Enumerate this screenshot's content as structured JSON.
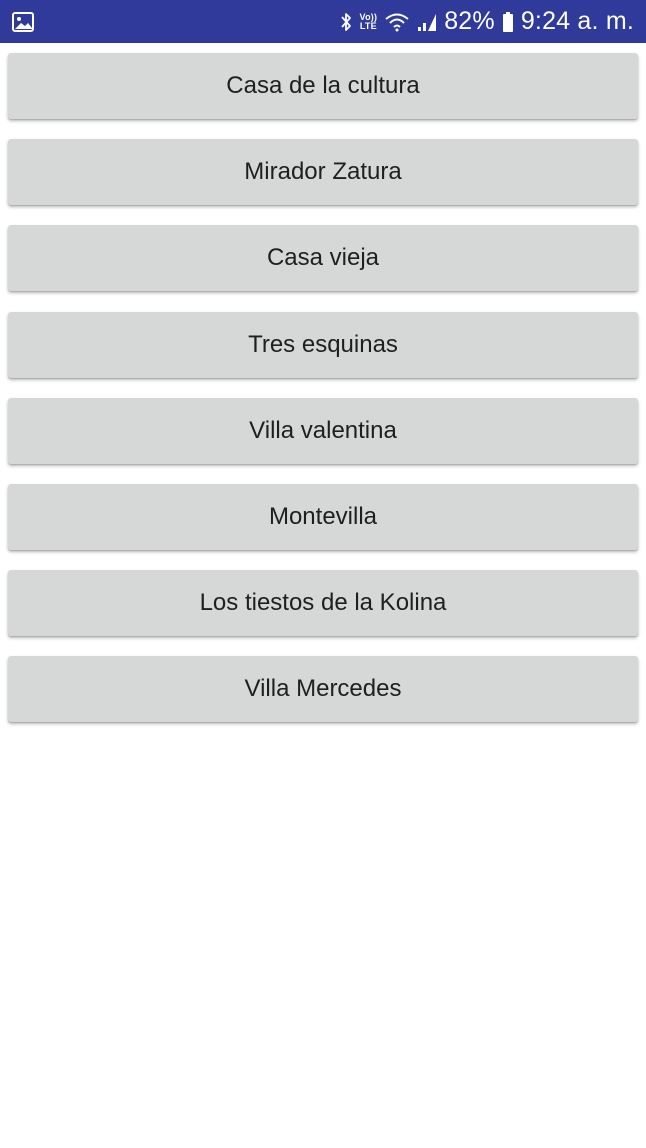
{
  "status_bar": {
    "battery": "82%",
    "time": "9:24 a. m.",
    "volte_top": "Vo))",
    "volte_bottom": "LTE",
    "icons": [
      "image-icon",
      "bluetooth-icon",
      "volte-icon",
      "wifi-icon",
      "signal-icon",
      "battery-icon"
    ],
    "background_color": "#2f3a9b"
  },
  "places": [
    {
      "label": "Casa de la cultura"
    },
    {
      "label": "Mirador Zatura"
    },
    {
      "label": "Casa vieja"
    },
    {
      "label": "Tres esquinas"
    },
    {
      "label": "Villa valentina"
    },
    {
      "label": "Montevilla"
    },
    {
      "label": "Los tiestos de la Kolina"
    },
    {
      "label": "Villa Mercedes"
    }
  ]
}
